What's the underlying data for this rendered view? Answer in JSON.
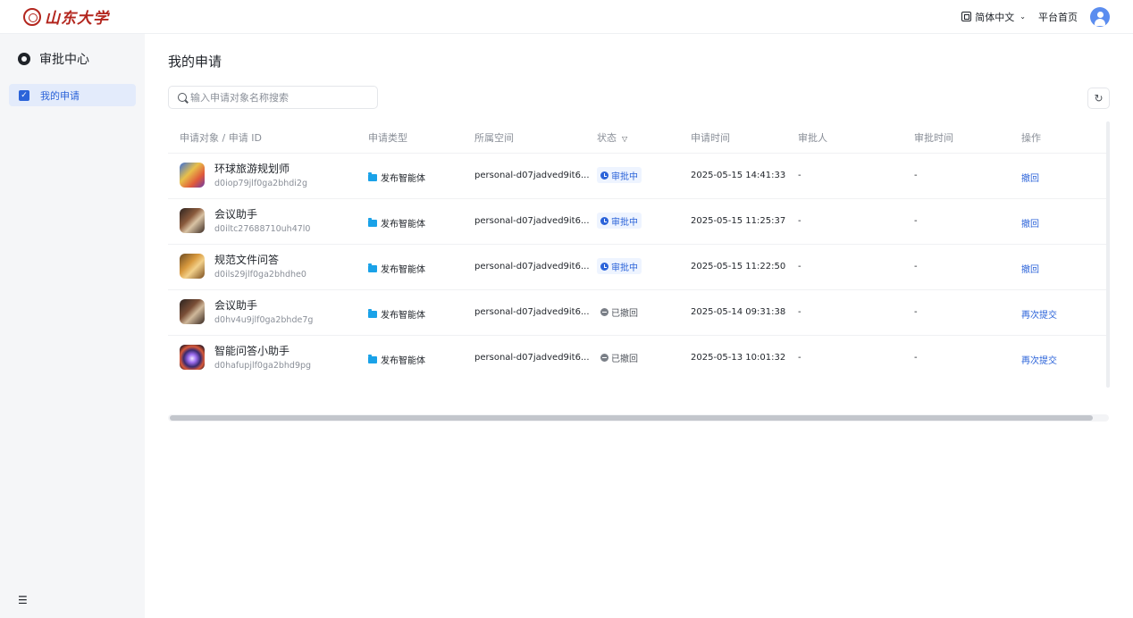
{
  "header": {
    "brand": "山东大学",
    "language": "简体中文",
    "home_link": "平台首页"
  },
  "sidebar": {
    "title": "审批中心",
    "items": [
      {
        "label": "我的申请",
        "active": true
      }
    ]
  },
  "main": {
    "page_title": "我的申请",
    "search_placeholder": "输入申请对象名称搜索",
    "columns": [
      "申请对象 / 申请 ID",
      "申请类型",
      "所属空间",
      "状态",
      "申请时间",
      "审批人",
      "审批时间",
      "操作"
    ],
    "rows": [
      {
        "name": "环球旅游规划师",
        "id": "d0iop79jlf0ga2bhdi2g",
        "type": "发布智能体",
        "space": "personal-d07jadved9it6...",
        "status": "审批中",
        "status_kind": "pending",
        "time": "2025-05-15 14:41:33",
        "approver": "-",
        "approve_time": "-",
        "action": "撤回"
      },
      {
        "name": "会议助手",
        "id": "d0iltc27688710uh47l0",
        "type": "发布智能体",
        "space": "personal-d07jadved9it6...",
        "status": "审批中",
        "status_kind": "pending",
        "time": "2025-05-15 11:25:37",
        "approver": "-",
        "approve_time": "-",
        "action": "撤回"
      },
      {
        "name": "规范文件问答",
        "id": "d0ils29jlf0ga2bhdhe0",
        "type": "发布智能体",
        "space": "personal-d07jadved9it6...",
        "status": "审批中",
        "status_kind": "pending",
        "time": "2025-05-15 11:22:50",
        "approver": "-",
        "approve_time": "-",
        "action": "撤回"
      },
      {
        "name": "会议助手",
        "id": "d0hv4u9jlf0ga2bhde7g",
        "type": "发布智能体",
        "space": "personal-d07jadved9it6...",
        "status": "已撤回",
        "status_kind": "revoked",
        "time": "2025-05-14 09:31:38",
        "approver": "-",
        "approve_time": "-",
        "action": "再次提交"
      },
      {
        "name": "智能问答小助手",
        "id": "d0hafupjlf0ga2bhd9pg",
        "type": "发布智能体",
        "space": "personal-d07jadved9it6...",
        "status": "已撤回",
        "status_kind": "revoked",
        "time": "2025-05-13 10:01:32",
        "approver": "-",
        "approve_time": "-",
        "action": "再次提交"
      }
    ]
  },
  "colors": {
    "accent": "#2b63d9",
    "brand": "#b3261e",
    "sidebar_bg": "#f5f6f8",
    "active_item_bg": "#e3ebfb"
  }
}
